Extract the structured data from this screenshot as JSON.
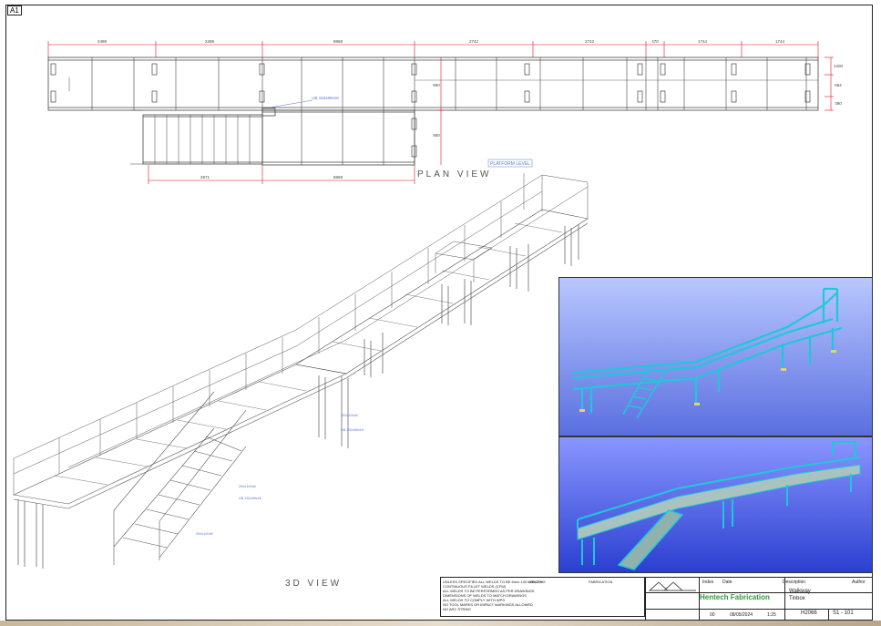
{
  "sheet": {
    "id": "A1"
  },
  "plan": {
    "label": "PLAN VIEW",
    "callout": "PLATFORM LEVEL",
    "beam_label": "UB 152x89x16",
    "top_dims": [
      "2489",
      "2489",
      "8868",
      "2742",
      "2742",
      "470",
      "1744",
      "1744"
    ],
    "bottom_dims": [
      "2871",
      "8868"
    ],
    "right_dims": [
      "1200",
      "964",
      "390"
    ],
    "mid_dims": [
      "900",
      "900"
    ]
  },
  "iso": {
    "label": "3D VIEW",
    "callouts": [
      "200x100x8",
      "UB 152x89x16",
      "200x100x8",
      "UB 152x89x16",
      "200x100x8"
    ]
  },
  "notes": {
    "lines": [
      "UNLESS SPECIFIED ALL WELDS TO BE 6mm 100 LENGTH",
      "CONTINUOUS FILLET WELDS (CFW)",
      "ALL WELDS TO BE PERFORMED AS PER DRAWINGS",
      "DIMENSIONS OF WELDS TO MATCH DRAWINGS",
      "ALL WELDS TO COMPLY WITH WPS",
      "NO TOOL MARKS OR IMPACT MARKINGS ALLOWED",
      "NO ARC STRIKE"
    ],
    "headers": [
      "WELDING",
      "FABRICATION"
    ]
  },
  "titleblock": {
    "company": "Hentech Fabrication",
    "headers": [
      "Index",
      "Date",
      "Description",
      "Author"
    ],
    "description": "Walkway",
    "sub": "Tinbox",
    "job": "H2066",
    "sheet": "S1 - 101",
    "rev": "00",
    "scale": "1:25",
    "date": "08/05/2024"
  },
  "colors": {
    "dim": "#e0141e",
    "steel": "#444444",
    "render_steel": "#1fc8d8",
    "deck": "#9fb6b8"
  }
}
